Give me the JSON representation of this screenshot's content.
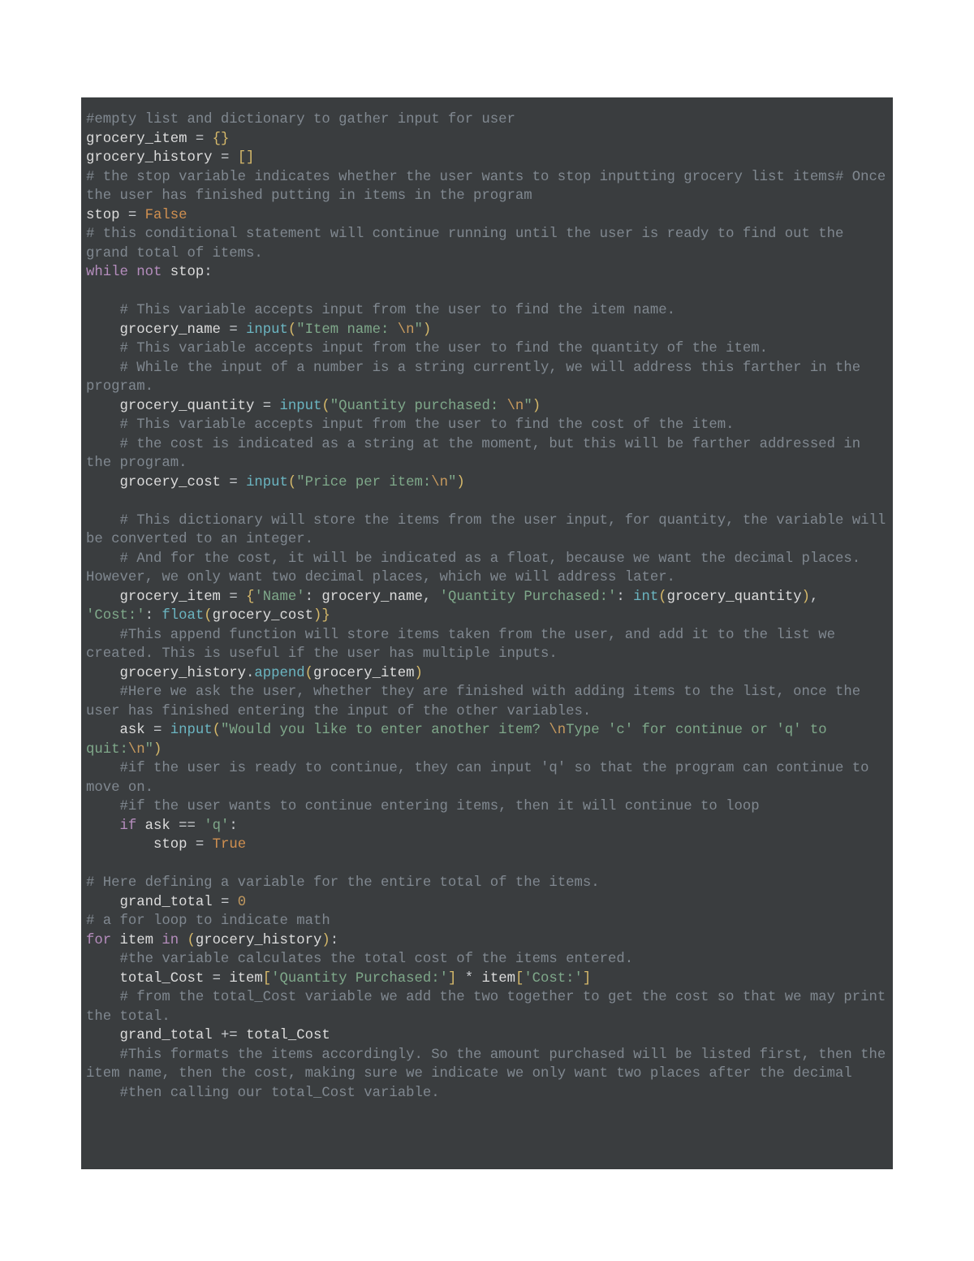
{
  "tokens": [
    {
      "id": "t1",
      "cls": "cm",
      "text": "#empty list and dictionary to gather input for user"
    },
    {
      "id": "t2",
      "cls": "def",
      "text": "grocery_item "
    },
    {
      "id": "t3",
      "cls": "op",
      "text": "= "
    },
    {
      "id": "t4",
      "cls": "br",
      "text": "{}"
    },
    {
      "id": "t5",
      "cls": "def",
      "text": "grocery_history "
    },
    {
      "id": "t6",
      "cls": "op",
      "text": "= "
    },
    {
      "id": "t7",
      "cls": "br",
      "text": "[]"
    },
    {
      "id": "t8",
      "cls": "cm",
      "text": "# the stop variable indicates whether the user wants to stop inputting grocery list items# Once the user has finished putting in items in the program"
    },
    {
      "id": "t9",
      "cls": "def",
      "text": "stop "
    },
    {
      "id": "t10",
      "cls": "op",
      "text": "= "
    },
    {
      "id": "t11",
      "cls": "bool",
      "text": "False"
    },
    {
      "id": "t12",
      "cls": "cm",
      "text": "# this conditional statement will continue running until the user is ready to find out the grand total of items."
    },
    {
      "id": "t13",
      "cls": "kw2",
      "text": "while not "
    },
    {
      "id": "t14",
      "cls": "def",
      "text": "stop"
    },
    {
      "id": "t15",
      "cls": "op",
      "text": ":"
    },
    {
      "id": "t16",
      "cls": "cm",
      "text": "# This variable accepts input from the user to find the item name."
    },
    {
      "id": "t17",
      "cls": "def",
      "text": "grocery_name "
    },
    {
      "id": "t18",
      "cls": "op",
      "text": "= "
    },
    {
      "id": "t19",
      "cls": "fn",
      "text": "input"
    },
    {
      "id": "t20",
      "cls": "br",
      "text": "("
    },
    {
      "id": "t21",
      "cls": "str",
      "text": "\"Item name: "
    },
    {
      "id": "t22",
      "cls": "esc",
      "text": "\\n"
    },
    {
      "id": "t23",
      "cls": "str",
      "text": "\""
    },
    {
      "id": "t24",
      "cls": "br",
      "text": ")"
    },
    {
      "id": "t25",
      "cls": "cm",
      "text": "# This variable accepts input from the user to find the quantity of the item."
    },
    {
      "id": "t26",
      "cls": "cm",
      "text": "# While the input of a number is a string currently, we will address this farther in the program."
    },
    {
      "id": "t27",
      "cls": "def",
      "text": "grocery_quantity "
    },
    {
      "id": "t28",
      "cls": "op",
      "text": "= "
    },
    {
      "id": "t29",
      "cls": "fn",
      "text": "input"
    },
    {
      "id": "t30",
      "cls": "br",
      "text": "("
    },
    {
      "id": "t31",
      "cls": "str",
      "text": "\"Quantity purchased: "
    },
    {
      "id": "t32",
      "cls": "esc",
      "text": "\\n"
    },
    {
      "id": "t33",
      "cls": "str",
      "text": "\""
    },
    {
      "id": "t34",
      "cls": "br",
      "text": ")"
    },
    {
      "id": "t35",
      "cls": "cm",
      "text": "# This variable accepts input from the user to find the cost of the item."
    },
    {
      "id": "t36",
      "cls": "cm",
      "text": "# the cost is indicated as a string at the moment, but this will be farther addressed in the program."
    },
    {
      "id": "t37",
      "cls": "def",
      "text": "grocery_cost "
    },
    {
      "id": "t38",
      "cls": "op",
      "text": "= "
    },
    {
      "id": "t39",
      "cls": "fn",
      "text": "input"
    },
    {
      "id": "t40",
      "cls": "br",
      "text": "("
    },
    {
      "id": "t41",
      "cls": "str",
      "text": "\"Price per item:"
    },
    {
      "id": "t42",
      "cls": "esc",
      "text": "\\n"
    },
    {
      "id": "t43",
      "cls": "str",
      "text": "\""
    },
    {
      "id": "t44",
      "cls": "br",
      "text": ")"
    },
    {
      "id": "t45",
      "cls": "cm",
      "text": "# This dictionary will store the items from the user input, for quantity, the variable will be converted to an integer."
    },
    {
      "id": "t46",
      "cls": "cm",
      "text": "# And for the cost, it will be indicated as a float, because we want the decimal places. However, we only want two decimal places, which we will address later."
    },
    {
      "id": "t47",
      "cls": "def",
      "text": "grocery_item "
    },
    {
      "id": "t48",
      "cls": "op",
      "text": "= "
    },
    {
      "id": "t49",
      "cls": "br",
      "text": "{"
    },
    {
      "id": "t50",
      "cls": "str",
      "text": "'Name'"
    },
    {
      "id": "t51",
      "cls": "op",
      "text": ": "
    },
    {
      "id": "t52",
      "cls": "def",
      "text": "grocery_name"
    },
    {
      "id": "t53",
      "cls": "op",
      "text": ", "
    },
    {
      "id": "t54",
      "cls": "str",
      "text": "'Quantity Purchased:'"
    },
    {
      "id": "t55",
      "cls": "op",
      "text": ": "
    },
    {
      "id": "t56",
      "cls": "fn",
      "text": "int"
    },
    {
      "id": "t57",
      "cls": "br",
      "text": "("
    },
    {
      "id": "t58",
      "cls": "def",
      "text": "grocery_quantity"
    },
    {
      "id": "t59",
      "cls": "br",
      "text": ")"
    },
    {
      "id": "t60",
      "cls": "op",
      "text": ", "
    },
    {
      "id": "t61",
      "cls": "str",
      "text": "'Cost:'"
    },
    {
      "id": "t62",
      "cls": "op",
      "text": ": "
    },
    {
      "id": "t63",
      "cls": "fn",
      "text": "float"
    },
    {
      "id": "t64",
      "cls": "br",
      "text": "("
    },
    {
      "id": "t65",
      "cls": "def",
      "text": "grocery_cost"
    },
    {
      "id": "t66",
      "cls": "br",
      "text": ")"
    },
    {
      "id": "t67",
      "cls": "br",
      "text": "}"
    },
    {
      "id": "t68",
      "cls": "cm",
      "text": "#This append function will store items taken from the user, and add it to the list we created. This is useful if the user has multiple inputs."
    },
    {
      "id": "t69",
      "cls": "def",
      "text": "grocery_history"
    },
    {
      "id": "t70",
      "cls": "op",
      "text": "."
    },
    {
      "id": "t71",
      "cls": "fn",
      "text": "append"
    },
    {
      "id": "t72",
      "cls": "br",
      "text": "("
    },
    {
      "id": "t73",
      "cls": "def",
      "text": "grocery_item"
    },
    {
      "id": "t74",
      "cls": "br",
      "text": ")"
    },
    {
      "id": "t75",
      "cls": "cm",
      "text": "#Here we ask the user, whether they are finished with adding items to the list, once the user has finished entering the input of the other variables."
    },
    {
      "id": "t76",
      "cls": "def",
      "text": "ask "
    },
    {
      "id": "t77",
      "cls": "op",
      "text": "= "
    },
    {
      "id": "t78",
      "cls": "fn",
      "text": "input"
    },
    {
      "id": "t79",
      "cls": "br",
      "text": "("
    },
    {
      "id": "t80",
      "cls": "str",
      "text": "\"Would you like to enter another item? "
    },
    {
      "id": "t81",
      "cls": "esc",
      "text": "\\n"
    },
    {
      "id": "t82",
      "cls": "str",
      "text": "Type 'c' for continue or 'q' to quit:"
    },
    {
      "id": "t83",
      "cls": "esc",
      "text": "\\n"
    },
    {
      "id": "t84",
      "cls": "str",
      "text": "\""
    },
    {
      "id": "t85",
      "cls": "br",
      "text": ")"
    },
    {
      "id": "t86",
      "cls": "cm",
      "text": "#if the user is ready to continue, they can input 'q' so that the program can continue to move on."
    },
    {
      "id": "t87",
      "cls": "cm",
      "text": "#if the user wants to continue entering items, then it will continue to loop"
    },
    {
      "id": "t88",
      "cls": "kw2",
      "text": "if "
    },
    {
      "id": "t89",
      "cls": "def",
      "text": "ask "
    },
    {
      "id": "t90",
      "cls": "op",
      "text": "== "
    },
    {
      "id": "t91",
      "cls": "str",
      "text": "'q'"
    },
    {
      "id": "t92",
      "cls": "op",
      "text": ":"
    },
    {
      "id": "t93",
      "cls": "def",
      "text": "stop "
    },
    {
      "id": "t94",
      "cls": "op",
      "text": "= "
    },
    {
      "id": "t95",
      "cls": "bool",
      "text": "True"
    },
    {
      "id": "t96",
      "cls": "cm",
      "text": "# Here defining a variable for the entire total of the items."
    },
    {
      "id": "t97",
      "cls": "def",
      "text": "grand_total "
    },
    {
      "id": "t98",
      "cls": "op",
      "text": "= "
    },
    {
      "id": "t99",
      "cls": "num",
      "text": "0"
    },
    {
      "id": "t100",
      "cls": "cm",
      "text": "# a for loop to indicate math"
    },
    {
      "id": "t101",
      "cls": "kw2",
      "text": "for "
    },
    {
      "id": "t102",
      "cls": "def",
      "text": "item "
    },
    {
      "id": "t103",
      "cls": "kw2",
      "text": "in "
    },
    {
      "id": "t104",
      "cls": "br",
      "text": "("
    },
    {
      "id": "t105",
      "cls": "def",
      "text": "grocery_history"
    },
    {
      "id": "t106",
      "cls": "br",
      "text": ")"
    },
    {
      "id": "t107",
      "cls": "op",
      "text": ":"
    },
    {
      "id": "t108",
      "cls": "cm",
      "text": "#the variable calculates the total cost of the items entered."
    },
    {
      "id": "t109",
      "cls": "def",
      "text": "total_Cost "
    },
    {
      "id": "t110",
      "cls": "op",
      "text": "= "
    },
    {
      "id": "t111",
      "cls": "def",
      "text": "item"
    },
    {
      "id": "t112",
      "cls": "br",
      "text": "["
    },
    {
      "id": "t113",
      "cls": "str",
      "text": "'Quantity Purchased:'"
    },
    {
      "id": "t114",
      "cls": "br",
      "text": "]"
    },
    {
      "id": "t115",
      "cls": "op",
      "text": " * "
    },
    {
      "id": "t116",
      "cls": "def",
      "text": "item"
    },
    {
      "id": "t117",
      "cls": "br",
      "text": "["
    },
    {
      "id": "t118",
      "cls": "str",
      "text": "'Cost:'"
    },
    {
      "id": "t119",
      "cls": "br",
      "text": "]"
    },
    {
      "id": "t120",
      "cls": "cm",
      "text": "# from the total_Cost variable we add the two together to get the cost so that we may print the total."
    },
    {
      "id": "t121",
      "cls": "def",
      "text": "grand_total "
    },
    {
      "id": "t122",
      "cls": "op",
      "text": "+= "
    },
    {
      "id": "t123",
      "cls": "def",
      "text": "total_Cost"
    },
    {
      "id": "t124",
      "cls": "cm",
      "text": "#This formats the items accordingly. So the amount purchased will be listed first, then the item name, then the cost, making sure we indicate we only want two places after the decimal"
    },
    {
      "id": "t125",
      "cls": "cm",
      "text": "#then calling our total_Cost variable."
    },
    {
      "id": "ind1",
      "cls": "indent",
      "text": "    "
    },
    {
      "id": "ind2",
      "cls": "indent",
      "text": "        "
    }
  ]
}
